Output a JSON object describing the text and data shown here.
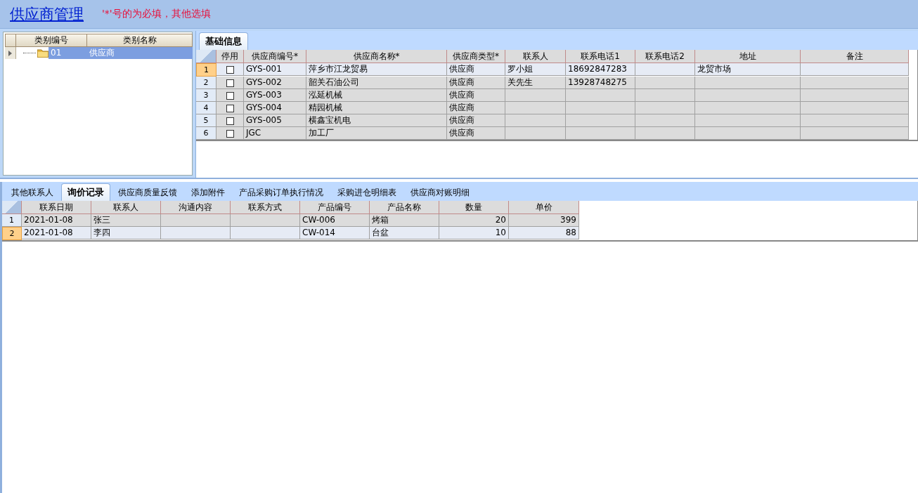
{
  "header": {
    "title": "供应商管理",
    "note": "'*'号的为必填，其他选填"
  },
  "category_tree": {
    "columns": [
      "类别编号",
      "类别名称"
    ],
    "rows": [
      {
        "code": "01",
        "name": "供应商",
        "selected": true
      }
    ]
  },
  "top_tabs": [
    {
      "label": "基础信息",
      "selected": true
    }
  ],
  "suppliers": {
    "check_column": "停用",
    "columns": [
      "供应商编号*",
      "供应商名称*",
      "供应商类型*",
      "联系人",
      "联系电话1",
      "联系电话2",
      "地址",
      "备注"
    ],
    "rows": [
      {
        "number": "1",
        "selected": true,
        "disabled": false,
        "cells": [
          "GYS-001",
          "萍乡市江龙贸易",
          "供应商",
          "罗小姐",
          "18692847283",
          "",
          "龙贸市场",
          ""
        ]
      },
      {
        "number": "2",
        "selected": false,
        "disabled": false,
        "cells": [
          "GYS-002",
          "韶关石油公司",
          "供应商",
          "关先生",
          "13928748275",
          "",
          "",
          ""
        ]
      },
      {
        "number": "3",
        "selected": false,
        "disabled": false,
        "cells": [
          "GYS-003",
          "泓延机械",
          "供应商",
          "",
          "",
          "",
          "",
          ""
        ]
      },
      {
        "number": "4",
        "selected": false,
        "disabled": false,
        "cells": [
          "GYS-004",
          "精园机械",
          "供应商",
          "",
          "",
          "",
          "",
          ""
        ]
      },
      {
        "number": "5",
        "selected": false,
        "disabled": false,
        "cells": [
          "GYS-005",
          "横鑫宝机电",
          "供应商",
          "",
          "",
          "",
          "",
          ""
        ]
      },
      {
        "number": "6",
        "selected": false,
        "disabled": false,
        "cells": [
          "JGC",
          "加工厂",
          "供应商",
          "",
          "",
          "",
          "",
          ""
        ]
      }
    ]
  },
  "bottom_tabs": [
    {
      "label": "其他联系人",
      "selected": false
    },
    {
      "label": "询价记录",
      "selected": true
    },
    {
      "label": "供应商质量反馈",
      "selected": false
    },
    {
      "label": "添加附件",
      "selected": false
    },
    {
      "label": "产品采购订单执行情况",
      "selected": false
    },
    {
      "label": "采购进仓明细表",
      "selected": false
    },
    {
      "label": "供应商对账明细",
      "selected": false
    }
  ],
  "inquiries": {
    "columns": [
      "联系日期",
      "联系人",
      "沟通内容",
      "联系方式",
      "产品编号",
      "产品名称",
      "数量",
      "单价"
    ],
    "rows": [
      {
        "number": "1",
        "selected": false,
        "cells": [
          "2021-01-08",
          "张三",
          "",
          "",
          "CW-006",
          "烤箱",
          "20",
          "399"
        ]
      },
      {
        "number": "2",
        "selected": true,
        "cells": [
          "2021-01-08",
          "李四",
          "",
          "",
          "CW-014",
          "台盆",
          "10",
          "88"
        ]
      }
    ]
  }
}
